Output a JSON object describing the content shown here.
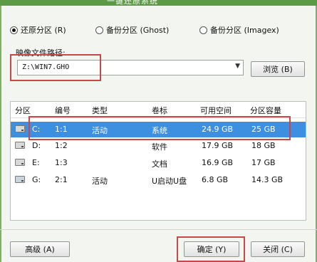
{
  "window": {
    "title": "一键还原系统"
  },
  "modes": [
    {
      "label": "还原分区 (R)",
      "selected": true
    },
    {
      "label": "备份分区 (Ghost)",
      "selected": false
    },
    {
      "label": "备份分区 (Imagex)",
      "selected": false
    }
  ],
  "image_path": {
    "label": "映像文件路径:",
    "value": "Z:\\WIN7.GHO",
    "browse_label": "浏览 (B)"
  },
  "table": {
    "headers": [
      "分区",
      "编号",
      "类型",
      "卷标",
      "可用空间",
      "分区容量"
    ],
    "rows": [
      {
        "drive": "C:",
        "num": "1:1",
        "type": "活动",
        "volume": "系统",
        "free": "24.9 GB",
        "size": "25 GB",
        "icon": "hard-drive-icon"
      },
      {
        "drive": "D:",
        "num": "1:2",
        "type": "",
        "volume": "软件",
        "free": "17.9 GB",
        "size": "18 GB",
        "icon": "hard-drive-icon"
      },
      {
        "drive": "E:",
        "num": "1:3",
        "type": "",
        "volume": "文档",
        "free": "16.9 GB",
        "size": "17 GB",
        "icon": "hard-drive-icon"
      },
      {
        "drive": "G:",
        "num": "2:1",
        "type": "活动",
        "volume": "U启动U盘",
        "free": "6.8 GB",
        "size": "14.3 GB",
        "icon": "usb-drive-icon"
      }
    ]
  },
  "buttons": {
    "advanced": "高级 (A)",
    "ok": "确定 (Y)",
    "close": "关闭 (C)"
  },
  "colors": {
    "selection": "#3d8fe0",
    "highlight_box": "#c9474a",
    "title_bar": "#5c9a45"
  }
}
